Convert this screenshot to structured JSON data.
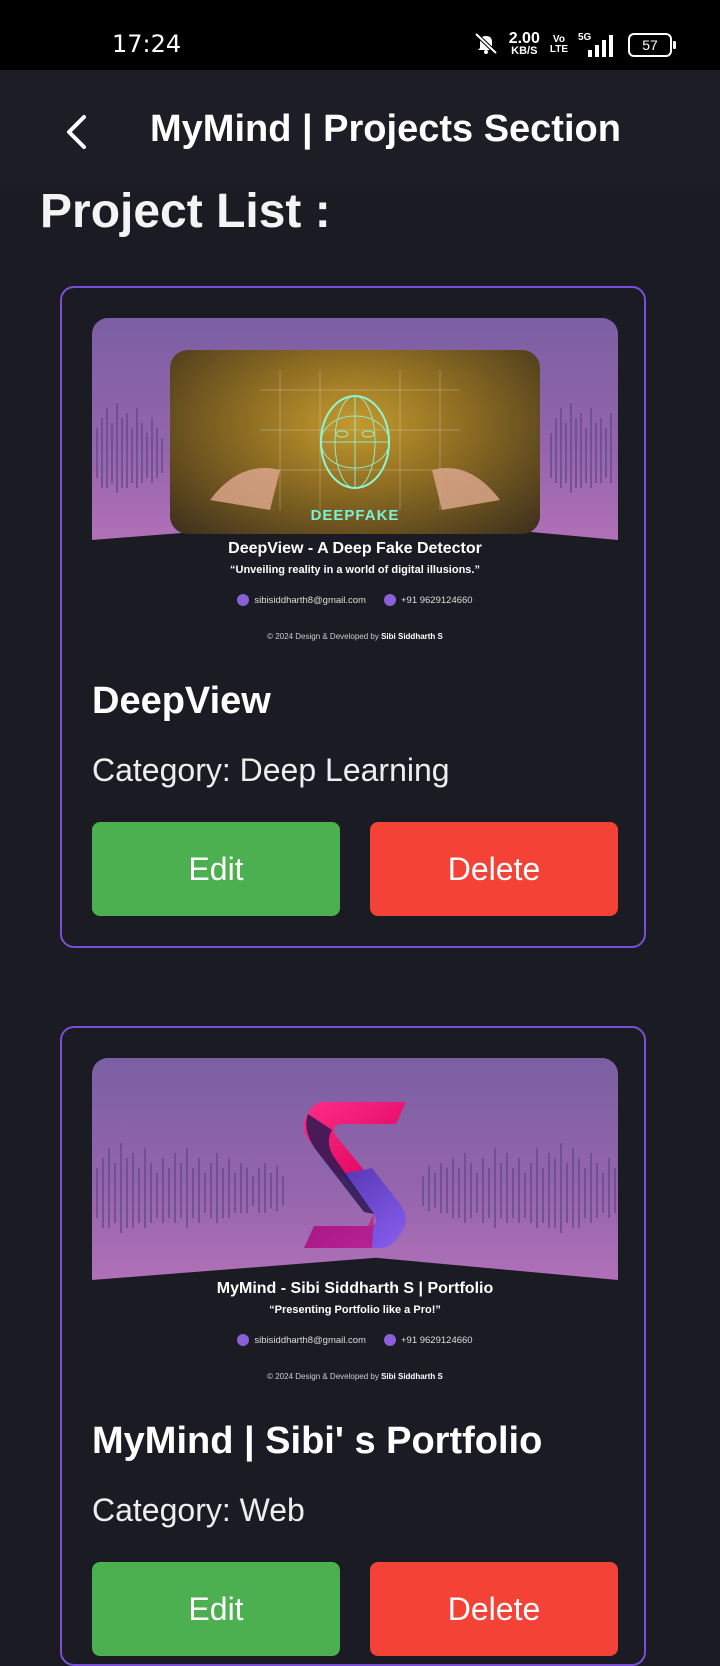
{
  "status_bar": {
    "time": "17:24",
    "net_speed_value": "2.00",
    "net_speed_unit": "KB/S",
    "volte_top": "Vo",
    "volte_bottom": "LTE",
    "network": "5G",
    "battery": "57"
  },
  "app_bar": {
    "title": "MyMind | Projects Section",
    "back_icon": "chevron-left-icon"
  },
  "section_title": "Project List :",
  "projects": [
    {
      "banner_title": "DeepView - A Deep Fake Detector",
      "banner_tagline": "“Unveiling reality in a world of digital illusions.”",
      "banner_image_text": "DEEPFAKE",
      "email": "sibisiddharth8@gmail.com",
      "phone": "+91 9629124660",
      "footer_prefix": "© 2024 Design & Developed by",
      "footer_name": "Sibi Siddharth S",
      "name": "DeepView",
      "category": "Category: Deep Learning",
      "edit_label": "Edit",
      "delete_label": "Delete"
    },
    {
      "banner_title": "MyMind - Sibi Siddharth S | Portfolio",
      "banner_tagline": "“Presenting Portfolio like a Pro!”",
      "email": "sibisiddharth8@gmail.com",
      "phone": "+91 9629124660",
      "footer_prefix": "© 2024 Design  & Developed by",
      "footer_name": "Sibi Siddharth S",
      "name": "MyMind | Sibi' s Portfolio",
      "category": "Category: Web",
      "edit_label": "Edit",
      "delete_label": "Delete"
    }
  ],
  "colors": {
    "background": "#1b1b23",
    "card_border": "#7a4fd6",
    "edit": "#4caf50",
    "delete": "#f44336"
  }
}
